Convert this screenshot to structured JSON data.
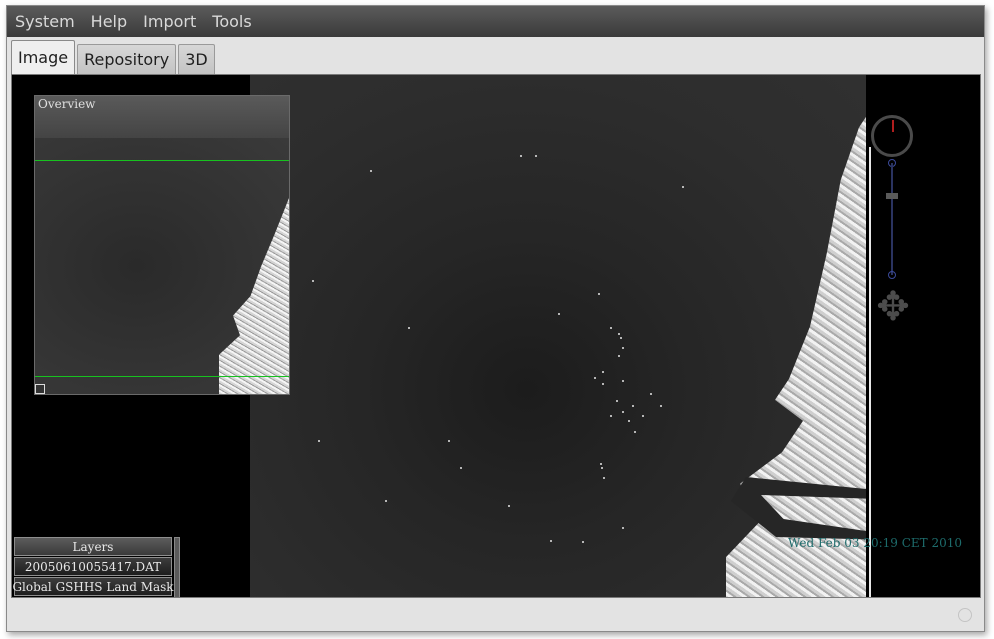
{
  "menu": {
    "items": [
      {
        "label": "System"
      },
      {
        "label": "Help"
      },
      {
        "label": "Import"
      },
      {
        "label": "Tools"
      }
    ]
  },
  "tabs": [
    {
      "label": "Image",
      "active": true
    },
    {
      "label": "Repository",
      "active": false
    },
    {
      "label": "3D",
      "active": false
    }
  ],
  "overview": {
    "title": "Overview"
  },
  "layers": {
    "header": "Layers",
    "items": [
      {
        "label": "20050610055417.DAT"
      },
      {
        "label": "Global GSHHS Land Mask"
      }
    ]
  },
  "timestamp": "Wed Feb 03 20:19 CET 2010",
  "icons": {
    "compass": "compass-icon",
    "zoom": "zoom-slider",
    "pan": "pan-arrows-icon",
    "overview_toggle": "overview-toggle-icon",
    "status": "status-indicator-icon"
  },
  "colors": {
    "overview_lines": "#17c21f",
    "timestamp": "#1d6b6b",
    "compass_needle": "#b01e1e"
  }
}
